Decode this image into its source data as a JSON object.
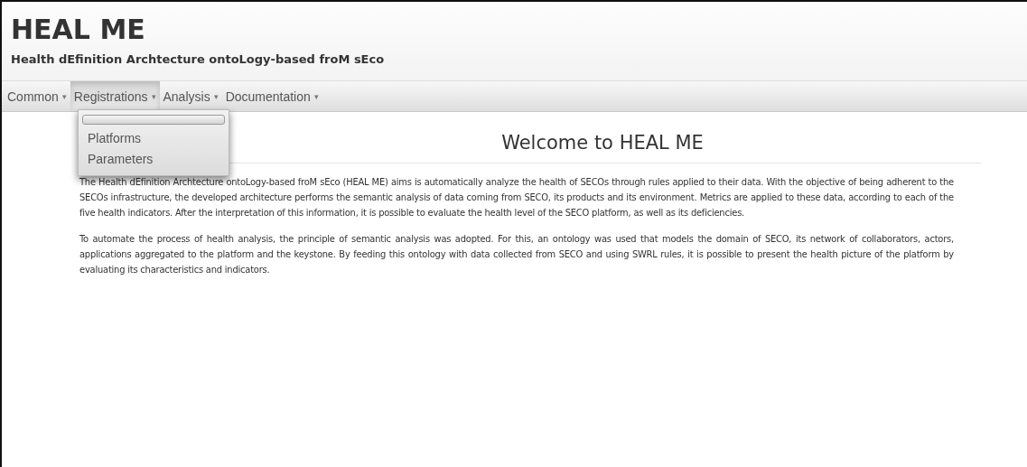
{
  "header": {
    "title": "HEAL ME",
    "subtitle": "Health dEfinition Archtecture ontoLogy-based froM sEco"
  },
  "nav": [
    {
      "label": "Common",
      "caret": "▾",
      "selected": false
    },
    {
      "label": "Registrations",
      "caret": "▾",
      "selected": true
    },
    {
      "label": "Analysis",
      "caret": "▾",
      "selected": false
    },
    {
      "label": "Documentation",
      "caret": "▾",
      "selected": false
    }
  ],
  "dropdown": [
    {
      "kind": "blank"
    },
    {
      "kind": "item",
      "label": "Platforms"
    },
    {
      "kind": "item",
      "label": "Parameters"
    }
  ],
  "main": {
    "heading": "Welcome to HEAL ME",
    "paragraphs": [
      "The Health dEfinition Archtecture ontoLogy-based froM sEco (HEAL ME) aims is automatically analyze the health of SECOs through rules applied to their data. With the objective of being adherent to the SECOs infrastructure, the developed architecture performs the semantic analysis of data coming from SECO, its products and its environment. Metrics are applied to these data, according to each of the five health indicators. After the interpretation of this information, it is possible to evaluate the health level of the SECO platform, as well as its deficiencies.",
      "To automate the process of health analysis, the principle of semantic analysis was adopted. For this, an ontology was used that models the domain of SECO, its network of collaborators, actors, applications aggregated to the platform and the keystone. By feeding this ontology with data collected from SECO and using SWRL rules, it is possible to present the health picture of the platform by evaluating its characteristics and indicators."
    ]
  }
}
